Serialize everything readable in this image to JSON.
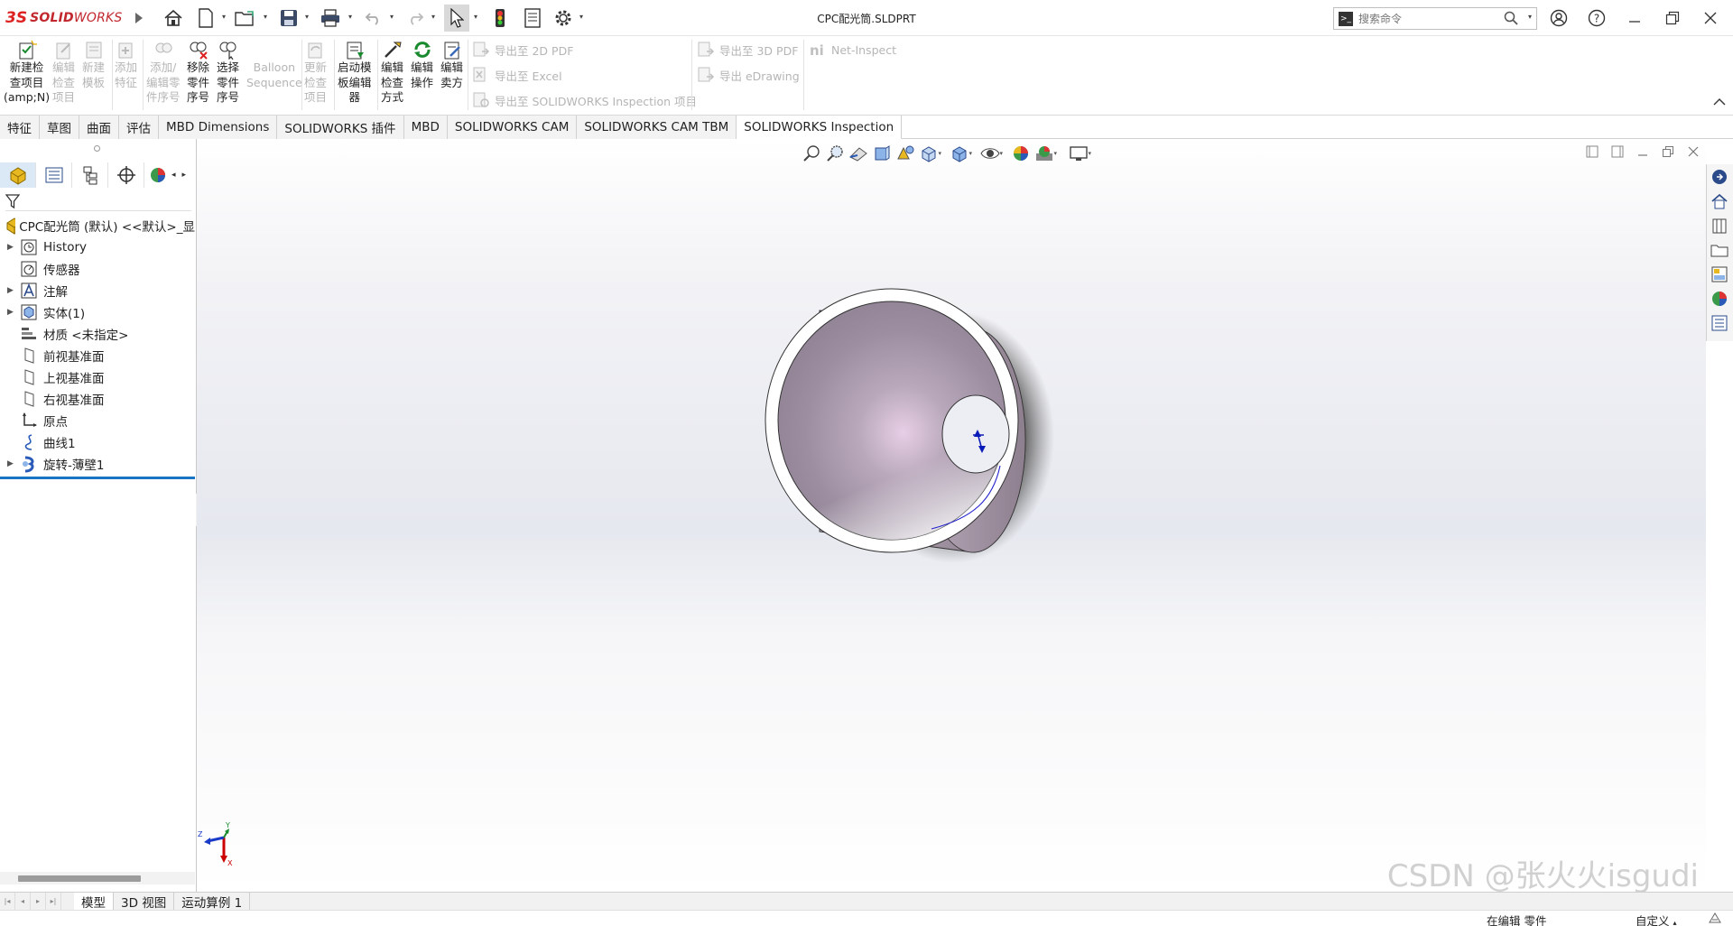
{
  "app": {
    "brand_ds": "3S",
    "brand_solid": "SOLID",
    "brand_works": "WORKS",
    "document_title": "CPC配光筒.SLDPRT"
  },
  "search": {
    "placeholder": "搜索命令"
  },
  "ribbon": {
    "new_inspection": [
      "新建检",
      "查项目",
      "(amp;N)"
    ],
    "edit_inspection": [
      "编辑",
      "检查",
      "项目"
    ],
    "new_template": [
      "新建",
      "模板"
    ],
    "add_feature": [
      "添加",
      "特征"
    ],
    "add_edit_balloon": [
      "添加/",
      "编辑零",
      "件序号"
    ],
    "remove_balloon": [
      "移除",
      "零件",
      "序号"
    ],
    "select_balloon": [
      "选择",
      "零件",
      "序号"
    ],
    "balloon_sequence": [
      "Balloon",
      "Sequence"
    ],
    "update_inspection": [
      "更新",
      "检查",
      "项目"
    ],
    "launch_template_editor": [
      "启动模",
      "板编辑",
      "器"
    ],
    "edit_inspection_method": [
      "编辑",
      "检查",
      "方式"
    ],
    "edit_operation": [
      "编辑",
      "操作"
    ],
    "edit_vendor": [
      "编辑",
      "卖方"
    ],
    "export_2d_pdf": "导出至 2D PDF",
    "export_excel": "导出至 Excel",
    "export_sw_inspection": "导出至 SOLIDWORKS Inspection 项目",
    "export_3d_pdf": "导出至 3D PDF",
    "export_edrawing": "导出 eDrawing",
    "net_inspect": "Net-Inspect"
  },
  "tabs": [
    {
      "label": "特征"
    },
    {
      "label": "草图"
    },
    {
      "label": "曲面"
    },
    {
      "label": "评估"
    },
    {
      "label": "MBD Dimensions"
    },
    {
      "label": "SOLIDWORKS 插件"
    },
    {
      "label": "MBD"
    },
    {
      "label": "SOLIDWORKS CAM"
    },
    {
      "label": "SOLIDWORKS CAM TBM"
    },
    {
      "label": "SOLIDWORKS Inspection"
    }
  ],
  "active_tab": "SOLIDWORKS Inspection",
  "tree": {
    "root": "CPC配光筒 (默认) <<默认>_显",
    "items": [
      {
        "label": "History"
      },
      {
        "label": "传感器"
      },
      {
        "label": "注解"
      },
      {
        "label": "实体(1)"
      },
      {
        "label": "材质 <未指定>"
      },
      {
        "label": "前视基准面"
      },
      {
        "label": "上视基准面"
      },
      {
        "label": "右视基准面"
      },
      {
        "label": "原点"
      },
      {
        "label": "曲线1"
      },
      {
        "label": "旋转-薄壁1"
      }
    ]
  },
  "triad": {
    "y": "Y",
    "z": "Z",
    "x": "X"
  },
  "bottom_tabs": [
    {
      "label": "模型"
    },
    {
      "label": "3D 视图"
    },
    {
      "label": "运动算例 1"
    }
  ],
  "status": {
    "editing": "在编辑 零件",
    "custom": "自定义"
  },
  "watermark": "CSDN @张火火isgudi",
  "colors": {
    "brand_red": "#c1272d",
    "tree_selection": "#1a74c4",
    "model_inner": "#a698a8",
    "model_shadow": "#555555"
  }
}
